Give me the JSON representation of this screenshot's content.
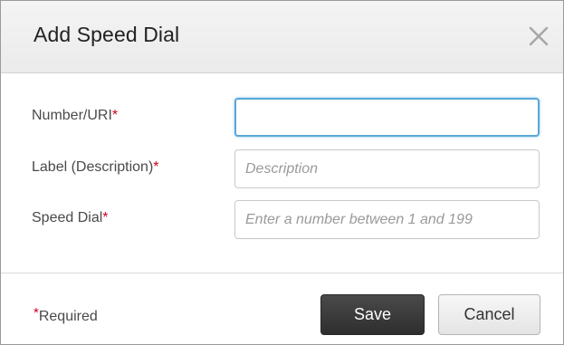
{
  "dialog": {
    "title": "Add Speed Dial",
    "close_icon": "close-icon"
  },
  "form": {
    "number_uri": {
      "label": "Number/URI",
      "required_mark": "*",
      "value": "",
      "placeholder": ""
    },
    "label_description": {
      "label": "Label (Description)",
      "required_mark": "*",
      "value": "",
      "placeholder": "Description"
    },
    "speed_dial": {
      "label": "Speed Dial",
      "required_mark": "*",
      "value": "",
      "placeholder": "Enter a number between 1 and 199"
    }
  },
  "footer": {
    "required_mark": "*",
    "required_text": "Required",
    "save_label": "Save",
    "cancel_label": "Cancel"
  },
  "colors": {
    "required_asterisk": "#d0021b",
    "focus_border": "#5aa7d8",
    "save_button_bg": "#3a3a3a"
  }
}
